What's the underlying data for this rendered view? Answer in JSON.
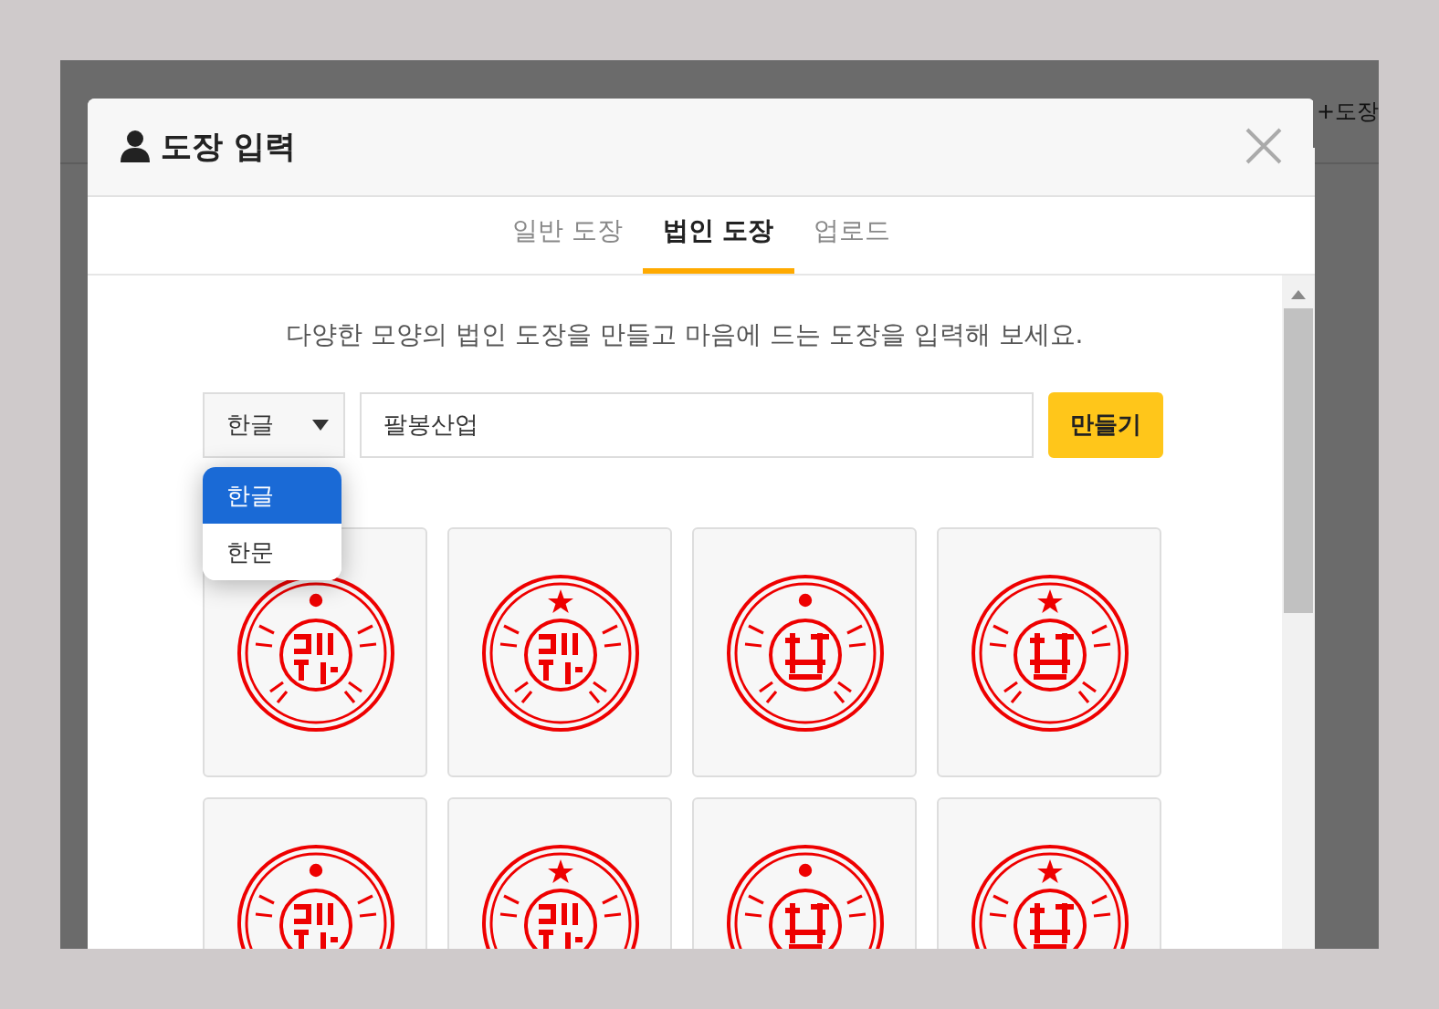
{
  "background_page": {
    "add_button": "+도장"
  },
  "dialog": {
    "title": "도장 입력",
    "tabs": [
      {
        "label": "일반 도장",
        "selected": false
      },
      {
        "label": "법인 도장",
        "selected": true
      },
      {
        "label": "업로드",
        "selected": false
      }
    ],
    "description": "다양한 모양의 법인 도장을 만들고 마음에 드는 도장을 입력해 보세요.",
    "script_select": {
      "value": "한글",
      "expanded": true,
      "options": [
        {
          "label": "한글",
          "selected": true
        },
        {
          "label": "한문",
          "selected": false
        }
      ]
    },
    "name_field": {
      "value": "팔봉산업"
    },
    "create_button": "만들기",
    "stamps": [
      {
        "kind": "hangul-dot"
      },
      {
        "kind": "hangul-star"
      },
      {
        "kind": "hanja-dot"
      },
      {
        "kind": "hanja-star"
      },
      {
        "kind": "hangul-dot"
      },
      {
        "kind": "hangul-star"
      },
      {
        "kind": "hanja-dot"
      },
      {
        "kind": "hanja-star"
      }
    ]
  }
}
